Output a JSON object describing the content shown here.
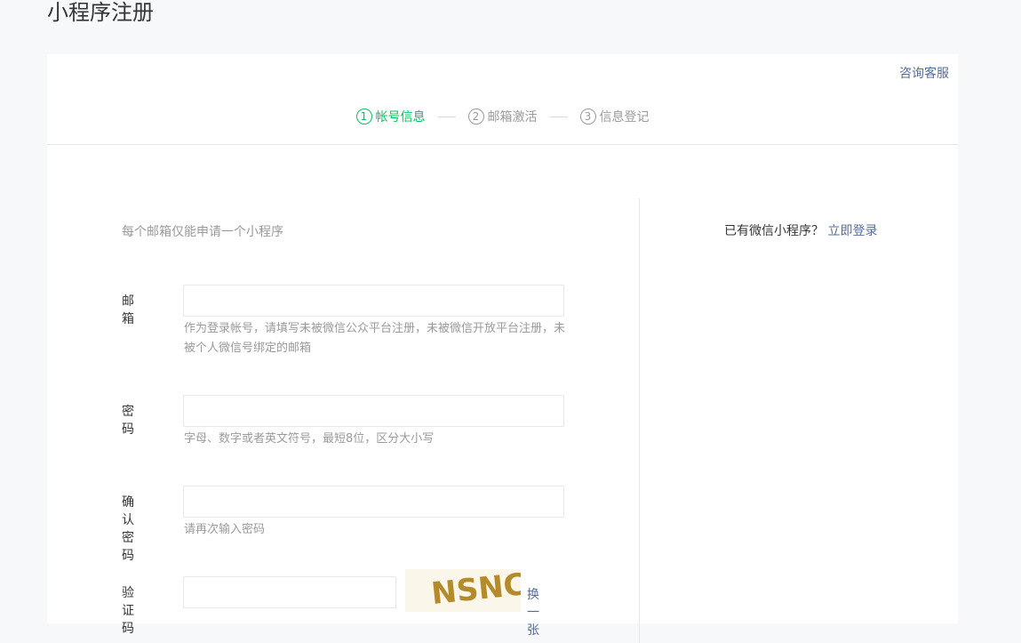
{
  "page": {
    "title": "小程序注册"
  },
  "header": {
    "consult_label": "咨询客服"
  },
  "steps": [
    {
      "num": "1",
      "label": "帐号信息",
      "active": true
    },
    {
      "num": "2",
      "label": "邮箱激活",
      "active": false
    },
    {
      "num": "3",
      "label": "信息登记",
      "active": false
    }
  ],
  "form": {
    "intro": "每个邮箱仅能申请一个小程序",
    "email": {
      "label": "邮箱",
      "value": "",
      "hint": "作为登录帐号，请填写未被微信公众平台注册，未被微信开放平台注册，未被个人微信号绑定的邮箱"
    },
    "password": {
      "label": "密码",
      "value": "",
      "hint": "字母、数字或者英文符号，最短8位，区分大小写"
    },
    "confirm": {
      "label": "确认密码",
      "value": "",
      "hint": "请再次输入密码"
    },
    "captcha": {
      "label": "验证码",
      "value": "",
      "image_text": "NSNC",
      "swap_label": "换一张"
    }
  },
  "aside": {
    "question": "已有微信小程序？",
    "login_label": "立即登录"
  },
  "colors": {
    "accent_green": "#07c160",
    "link_blue": "#576b95",
    "captcha_brown": "#b58a2a"
  }
}
